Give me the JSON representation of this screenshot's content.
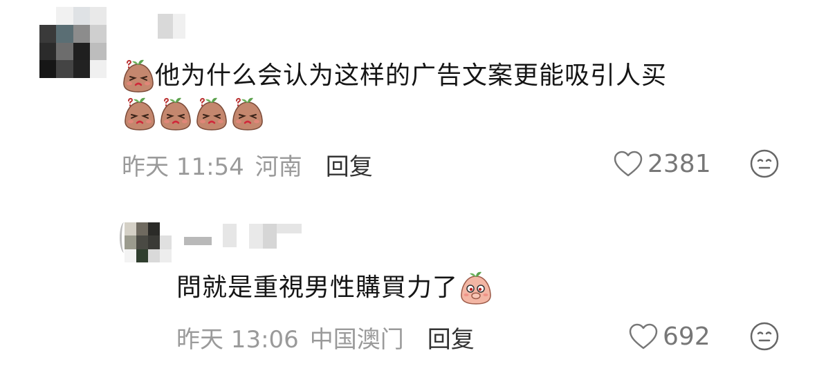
{
  "comment1": {
    "text": "他为什么会认为这样的广告文案更能吸引人买",
    "timestamp": "昨天 11:54",
    "location": "河南",
    "reply_label": "回复",
    "like_count": "2381",
    "trailing_emojis": [
      "sweat-potato-emoji",
      "sweat-potato-emoji",
      "sweat-potato-emoji",
      "sweat-potato-emoji"
    ]
  },
  "comment2": {
    "text": "問就是重視男性購買力了",
    "timestamp": "昨天 13:06",
    "location": "中国澳门",
    "reply_label": "回复",
    "like_count": "692"
  },
  "icons": {
    "like": "heart-outline-icon",
    "more": "meh-face-icon"
  },
  "colors": {
    "meta_text": "#9a9a9a",
    "reply_text": "#333333",
    "icon_stroke": "#777777"
  }
}
